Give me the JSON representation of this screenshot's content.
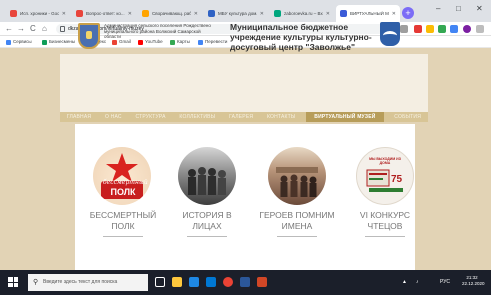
{
  "browser": {
    "tabs": [
      {
        "label": "Исп. хроники - Google Кр...",
        "color": "#e8453c"
      },
      {
        "label": "Вопрос-ответ: ко...",
        "color": "#e8453c"
      },
      {
        "label": "Сворачивающ. работы...",
        "color": "#ffa400"
      },
      {
        "label": "МБУ культура дом...",
        "color": "#2f62c4"
      },
      {
        "label": "zaboroevka.ru – Вх...",
        "color": "#00a67e"
      },
      {
        "label": "ВИРТУАЛЬНЫЙ МУЗЕЙ",
        "color": "#3b5bd8",
        "active": true
      }
    ],
    "new_tab": "+",
    "window_controls": {
      "minimize": "–",
      "maximize": "□",
      "close": "✕"
    },
    "nav": {
      "back": "←",
      "forward": "→",
      "reload": "C",
      "home": "⌂"
    },
    "url": "dkzavolzhye.com/virtualniy-muzey",
    "bookmarks": [
      {
        "label": "Сервисы",
        "color": "#4285f4"
      },
      {
        "label": "Бизнесмены",
        "color": "#0f9d58"
      },
      {
        "label": "Яндекс",
        "color": "#e53935"
      },
      {
        "label": "Gmail",
        "color": "#ea4335"
      },
      {
        "label": "YouTube",
        "color": "#ff0000"
      },
      {
        "label": "Карты",
        "color": "#34a853"
      },
      {
        "label": "Перевести",
        "color": "#4285f4"
      }
    ]
  },
  "site": {
    "admin_text": "Администрация сельского поселения Рождествено муниципального района Волжский Самарской области",
    "title": "Муниципальное бюджетное учреждение культуры культурно-досуговый центр \"Заволжье\"",
    "menu": [
      {
        "label": "Главная"
      },
      {
        "label": "О нас"
      },
      {
        "label": "Структура"
      },
      {
        "label": "Коллективы"
      },
      {
        "label": "Галерея"
      },
      {
        "label": "Контакты"
      },
      {
        "label": "Виртуальный музей",
        "active": true
      },
      {
        "label": "События"
      }
    ],
    "cards": [
      {
        "line1": "БЕССМЕРТНЫЙ",
        "line2": "ПОЛК",
        "badge": "ПОЛК",
        "script": "бессмертный"
      },
      {
        "line1": "ИСТОРИЯ В",
        "line2": "ЛИЦАХ"
      },
      {
        "line1": "ГЕРОЕВ ПОМНИМ",
        "line2": "ИМЕНА"
      },
      {
        "line1": "VI КОНКУРС",
        "line2": "ЧТЕЦОВ",
        "poster_top": "МЫ ВЫХОДИМ ИЗ ДОМА",
        "poster_number": "75"
      }
    ]
  },
  "taskbar": {
    "search_placeholder": "Введите здесь текст для поиска",
    "lang": "РУС",
    "time": "21:32",
    "date": "22.12.2020"
  }
}
